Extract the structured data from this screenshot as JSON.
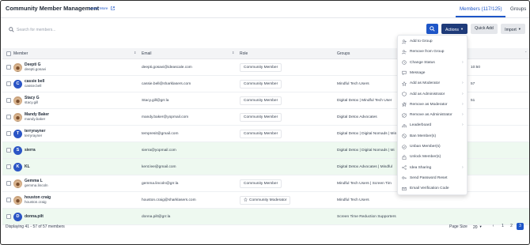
{
  "header": {
    "title": "Community Member Management",
    "learn_more": "Learn More",
    "tabs": [
      {
        "label": "Members (117/125)",
        "active": true
      },
      {
        "label": "Groups",
        "active": false
      }
    ]
  },
  "toolbar": {
    "search_placeholder": "Search for members...",
    "actions_label": "Actions",
    "quick_add_label": "Quick Add",
    "import_label": "Import",
    "accent_color": "#1e56c8"
  },
  "table": {
    "columns": [
      "Member",
      "Email",
      "Role",
      "Groups"
    ],
    "rows": [
      {
        "name": "Deepti G",
        "username": "deepti.gosavi",
        "avatar": "photo",
        "email": "deepti.gosavi@ideascale.com",
        "role": "Community Member",
        "groups": "",
        "extra": "10:50",
        "highlight": false
      },
      {
        "name": "cassie bell",
        "username": "cassie.bell",
        "avatar": "C",
        "email": "cassie.bell@sharklasers.com",
        "role": "Community Member",
        "groups": "Mindful Tech Users",
        "extra": "57",
        "highlight": false
      },
      {
        "name": "Stacy G",
        "username": "stacy.gill",
        "avatar": "photo",
        "email": "Stacy.gill@grr.la",
        "role": "Community Member",
        "groups": "Digital Detox | Mindful Tech User",
        "extra": "51",
        "highlight": false
      },
      {
        "name": "Mandy Baker",
        "username": "mandy.baker",
        "avatar": "photo",
        "email": "mandy.baker@yopmail.com",
        "role": "Community Member",
        "groups": "Digital Detox Advocates",
        "extra": "",
        "highlight": false
      },
      {
        "name": "terryrayner",
        "username": "terryrayner",
        "avatar": "T",
        "email": "tempresit@gmail.com",
        "role": "Community Member",
        "groups": "Digital Detox | Digital Nomads | Min",
        "extra": "",
        "highlight": false
      },
      {
        "name": "sierra",
        "username": "",
        "avatar": "S",
        "email": "sierra@yopmail.com",
        "role": "",
        "groups": "Digital Detox | Digital Nomads | Mi",
        "extra": "",
        "highlight": true
      },
      {
        "name": "KL",
        "username": "",
        "avatar": "K",
        "email": "kent.lee@gmail.com",
        "role": "",
        "groups": "Digital Detox Advocates | Mindful",
        "extra": "",
        "highlight": true
      },
      {
        "name": "Gemma L",
        "username": "gemma.lincoln",
        "avatar": "photo",
        "email": "gemma.lincoln@grr.la",
        "role": "Community Member",
        "groups": "Mindful Tech Users | Screen Tim",
        "extra": "",
        "highlight": false
      },
      {
        "name": "houston craig",
        "username": "houston.craig",
        "avatar": "photo",
        "email": "houston.craig@sharklasers.com",
        "role": "Community Moderator",
        "groups": "Mindful Tech Users",
        "extra": "",
        "highlight": false
      },
      {
        "name": "donna.pilt",
        "username": "",
        "avatar": "D",
        "email": "donna.pilt@grr.la",
        "role": "",
        "groups": "Screen Time Reduction Supporters",
        "extra": "",
        "highlight": true
      }
    ]
  },
  "actions_menu": [
    {
      "label": "Add to Group",
      "icon": "user-add-icon",
      "submenu": false
    },
    {
      "label": "Remove from Group",
      "icon": "user-remove-icon",
      "submenu": false
    },
    {
      "label": "Change Status",
      "icon": "status-icon",
      "submenu": true
    },
    {
      "label": "Message",
      "icon": "message-icon",
      "submenu": false
    },
    {
      "label": "Add as Moderator",
      "icon": "moderator-add-icon",
      "submenu": true
    },
    {
      "label": "Add as Administrator",
      "icon": "admin-add-icon",
      "submenu": true
    },
    {
      "label": "Remove as Moderator",
      "icon": "moderator-remove-icon",
      "submenu": true
    },
    {
      "label": "Remove as Administrator",
      "icon": "admin-remove-icon",
      "submenu": true
    },
    {
      "label": "Leaderboard",
      "icon": "leaderboard-icon",
      "submenu": true
    },
    {
      "label": "Ban Member(s)",
      "icon": "ban-icon",
      "submenu": false
    },
    {
      "label": "Unban Member(s)",
      "icon": "unban-icon",
      "submenu": false
    },
    {
      "label": "Unlock Member(s)",
      "icon": "unlock-icon",
      "submenu": false
    },
    {
      "label": "Idea Sharing",
      "icon": "share-icon",
      "submenu": true
    },
    {
      "label": "Send Password Reset",
      "icon": "key-icon",
      "submenu": false
    },
    {
      "label": "Email Verification Code",
      "icon": "mail-icon",
      "submenu": false
    }
  ],
  "footer": {
    "displaying": "Displaying 41 - 57 of 57 members",
    "page_size_label": "Page Size",
    "page_size_value": "20",
    "pages": [
      "1",
      "2",
      "3"
    ],
    "current_page": "3"
  }
}
